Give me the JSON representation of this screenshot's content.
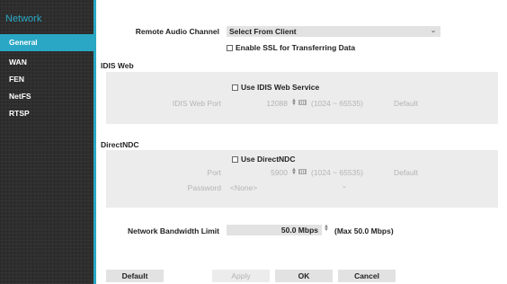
{
  "sidebar": {
    "title": "Network",
    "items": [
      {
        "label": "General",
        "active": true
      },
      {
        "label": "WAN"
      },
      {
        "label": "FEN"
      },
      {
        "label": "NetFS"
      },
      {
        "label": "RTSP"
      }
    ]
  },
  "general": {
    "remote_audio_label": "Remote Audio Channel",
    "remote_audio_value": "Select From Client",
    "ssl_label": "Enable SSL for Transferring Data"
  },
  "idis_web": {
    "section_title": "IDIS Web",
    "use_label": "Use IDIS Web Service",
    "port_label": "IDIS Web Port",
    "port_value": "12088",
    "port_range": "(1024 ~ 65535)",
    "default_label": "Default"
  },
  "directndc": {
    "section_title": "DirectNDC",
    "use_label": "Use DirectNDC",
    "port_label": "Port",
    "port_value": "5900",
    "port_range": "(1024 ~ 65535)",
    "default_label": "Default",
    "password_label": "Password",
    "password_value": "<None>"
  },
  "bandwidth": {
    "label": "Network Bandwidth Limit",
    "value": "50.0 Mbps",
    "max_text": "(Max 50.0 Mbps)"
  },
  "footer": {
    "default_label": "Default",
    "apply_label": "Apply",
    "ok_label": "OK",
    "cancel_label": "Cancel"
  }
}
